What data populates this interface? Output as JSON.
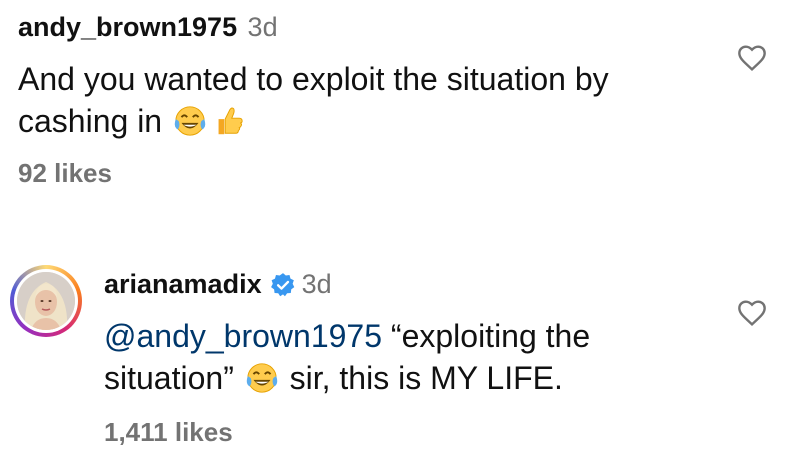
{
  "comments": [
    {
      "username": "andy_brown1975",
      "time": "3d",
      "text_before": "And you wanted to exploit the situation by cashing in",
      "emojis": [
        "face-with-tears-of-joy-icon",
        "thumbs-up-icon"
      ],
      "likes": "92 likes"
    },
    {
      "username": "arianamadix",
      "verified": true,
      "time": "3d",
      "mention": "@andy_brown1975",
      "text_part1": " “exploiting the situation”",
      "emoji": "face-with-tears-of-joy-icon",
      "text_part2": " sir, this is MY LIFE.",
      "likes": "1,411 likes"
    }
  ],
  "colors": {
    "text": "#111111",
    "secondary": "#737373",
    "mention": "#00376b",
    "verified": "#3897f0"
  }
}
